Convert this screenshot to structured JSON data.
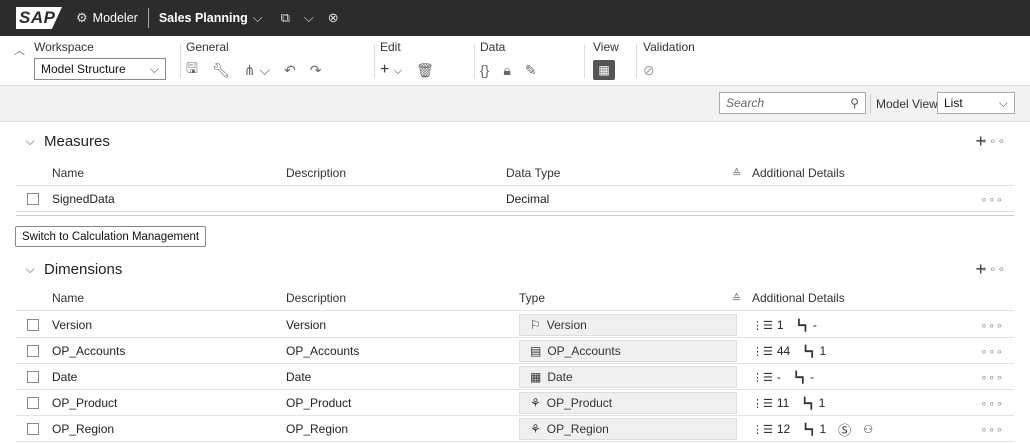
{
  "shell": {
    "logo": "SAP",
    "app": "Modeler",
    "model": "Sales Planning",
    "icons": [
      "gear-icon",
      "chevron-down-icon",
      "copy-window-icon",
      "close-circle-icon"
    ]
  },
  "toolbar": {
    "workspace_label": "Workspace",
    "workspace_value": "Model Structure",
    "general_label": "General",
    "edit_label": "Edit",
    "data_label": "Data",
    "view_label": "View",
    "validation_label": "Validation"
  },
  "filterbar": {
    "search_placeholder": "Search",
    "model_view_label": "Model View",
    "model_view_value": "List"
  },
  "measures": {
    "title": "Measures",
    "columns": [
      "Name",
      "Description",
      "Data Type",
      "Additional Details"
    ],
    "rows": [
      {
        "name": "SignedData",
        "description": "",
        "type": "Decimal"
      }
    ]
  },
  "calc_button": "Switch to Calculation Management",
  "dimensions": {
    "title": "Dimensions",
    "columns": [
      "Name",
      "Description",
      "Type",
      "Additional Details"
    ],
    "rows": [
      {
        "name": "Version",
        "description": "Version",
        "type": "Version",
        "type_icon": "version-icon",
        "members": "1",
        "hierarchies": "-",
        "extra": ""
      },
      {
        "name": "OP_Accounts",
        "description": "OP_Accounts",
        "type": "OP_Accounts",
        "type_icon": "account-icon",
        "members": "44",
        "hierarchies": "1",
        "extra": ""
      },
      {
        "name": "Date",
        "description": "Date",
        "type": "Date",
        "type_icon": "calendar-icon",
        "members": "-",
        "hierarchies": "-",
        "extra": ""
      },
      {
        "name": "OP_Product",
        "description": "OP_Product",
        "type": "OP_Product",
        "type_icon": "generic-dimension-icon",
        "members": "11",
        "hierarchies": "1",
        "extra": ""
      },
      {
        "name": "OP_Region",
        "description": "OP_Region",
        "type": "OP_Region",
        "type_icon": "generic-dimension-icon",
        "members": "12",
        "hierarchies": "1",
        "extra": "currency-and-responsible"
      }
    ]
  }
}
